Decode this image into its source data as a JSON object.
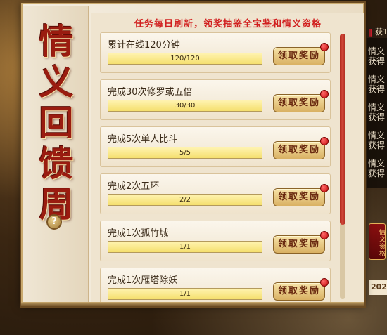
{
  "panel": {
    "title_chars": [
      "情",
      "义",
      "回",
      "馈",
      "周"
    ],
    "banner": "任务每日刷新，领奖抽鉴全宝鉴和情义资格",
    "help_glyph": "?"
  },
  "tasks": [
    {
      "name": "累计在线120分钟",
      "progress_text": "120/120",
      "progress": 1.0,
      "button": "领取奖励"
    },
    {
      "name": "完成30次修罗或五倍",
      "progress_text": "30/30",
      "progress": 1.0,
      "button": "领取奖励"
    },
    {
      "name": "完成5次单人比斗",
      "progress_text": "5/5",
      "progress": 1.0,
      "button": "领取奖励"
    },
    {
      "name": "完成2次五环",
      "progress_text": "2/2",
      "progress": 1.0,
      "button": "领取奖励"
    },
    {
      "name": "完成1次孤竹城",
      "progress_text": "1/1",
      "progress": 1.0,
      "button": "领取奖励"
    },
    {
      "name": "完成1次雁塔除妖",
      "progress_text": "1/1",
      "progress": 1.0,
      "button": "领取奖励"
    }
  ],
  "side": {
    "chat_head": "获1",
    "chat_mark": "‖",
    "messages": [
      {
        "a": "情义",
        "b": "获得"
      },
      {
        "a": "情义",
        "b": "获得"
      },
      {
        "a": "情义",
        "b": "获得"
      },
      {
        "a": "情义",
        "b": "获得"
      },
      {
        "a": "情义",
        "b": "获得"
      }
    ],
    "badge": "情义资格",
    "date": "202"
  },
  "colors": {
    "banner": "#d11f1f",
    "title": "#9a1c10",
    "scroll_thumb": "#b22b1f",
    "notify_dot": "#c40a0a"
  },
  "icons": {
    "help": "question-icon",
    "notify": "red-dot-icon"
  }
}
